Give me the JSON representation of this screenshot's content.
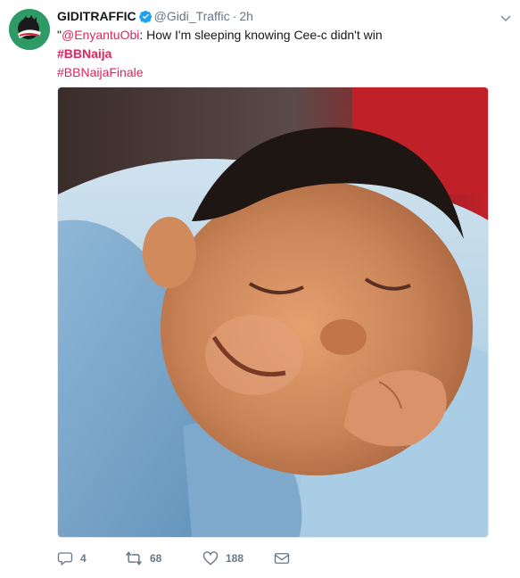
{
  "tweet": {
    "display_name": "GIDITRAFFIC",
    "handle": "@Gidi_Traffic",
    "separator": "·",
    "time": "2h",
    "text_prefix": "\"",
    "mention": "@EnyantuObi",
    "text_body": ": How I'm sleeping knowing Cee-c didn't win",
    "hashtag_1": "#BBNaija",
    "hashtag_2": "#BBNaijaFinale"
  },
  "media": {
    "description_icon": "photo-sleeping-baby"
  },
  "actions": {
    "reply_count": "4",
    "retweet_count": "68",
    "like_count": "188"
  },
  "colors": {
    "hashtag": "#e0245e",
    "muted": "#657786",
    "verified": "#1da1f2",
    "avatar_bg": "#2e9b67"
  }
}
